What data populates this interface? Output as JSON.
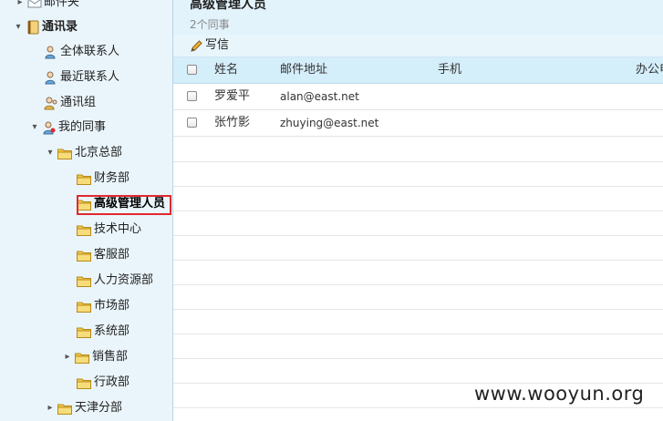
{
  "sidebar": {
    "mail_folder": "邮件夹",
    "contacts_root": "通讯录",
    "items": [
      {
        "label": "全体联系人"
      },
      {
        "label": "最近联系人"
      },
      {
        "label": "通讯组"
      },
      {
        "label": "我的同事"
      }
    ],
    "org": {
      "hq": "北京总部",
      "departments": [
        "财务部",
        "高级管理人员",
        "技术中心",
        "客服部",
        "人力资源部",
        "市场部",
        "系统部",
        "销售部",
        "行政部"
      ],
      "branch": "天津分部"
    },
    "toggles": {
      "collapsed": "▸",
      "expanded": "▾"
    }
  },
  "main": {
    "title": "高级管理人员",
    "subtitle": "2个同事",
    "compose_label": "写信",
    "columns": [
      "姓名",
      "邮件地址",
      "手机",
      "办公电"
    ],
    "rows": [
      {
        "name": "罗爱平",
        "email": "alan@east.net",
        "mobile": "",
        "office": ""
      },
      {
        "name": "张竹影",
        "email": "zhuying@east.net",
        "mobile": "",
        "office": ""
      }
    ]
  },
  "watermark": "www.wooyun.org",
  "colors": {
    "sidebar_bg": "#eaf5fb",
    "header_bg": "#e2f3fb",
    "table_head_bg": "#d4eefa",
    "highlight": "#e0292f",
    "folder": "#f2c94c"
  }
}
